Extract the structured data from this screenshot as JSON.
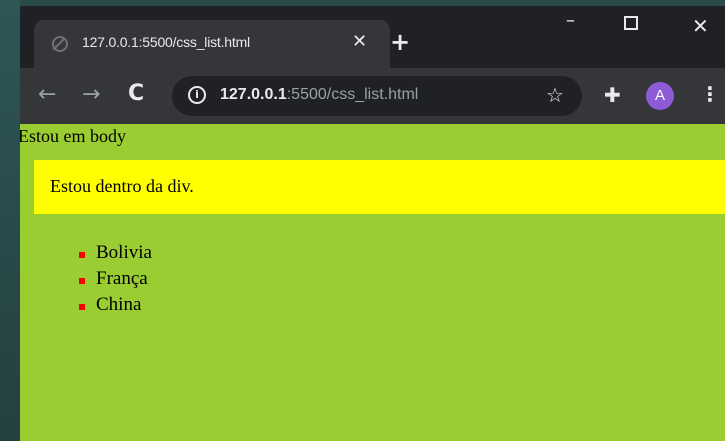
{
  "browser": {
    "tab": {
      "title": "127.0.0.1:5500/css_list.html",
      "close": "✕"
    },
    "new_tab": "+",
    "window_controls": {
      "minimize": "–",
      "close": "✕"
    },
    "toolbar": {
      "back": "←",
      "forward": "→",
      "reload": "C",
      "url_host": "127.0.0.1",
      "url_rest": ":5500/css_list.html",
      "avatar_letter": "A"
    }
  },
  "page": {
    "body_text": "Estou em body",
    "div_text": "Estou dentro da div.",
    "list_items": [
      "Bolivia",
      "França",
      "China"
    ]
  },
  "colors": {
    "page_background": "#9acd32",
    "div_background": "#ffff00",
    "bullet": "#ff0000",
    "browser_frame": "#202124",
    "toolbar": "#35363a",
    "avatar": "#8e5bd6"
  },
  "icons": [
    "favicon-icon",
    "close-icon",
    "plus-icon",
    "minimize-icon",
    "maximize-icon",
    "back-icon",
    "forward-icon",
    "reload-icon",
    "info-icon",
    "star-icon",
    "extensions-icon",
    "menu-icon"
  ]
}
